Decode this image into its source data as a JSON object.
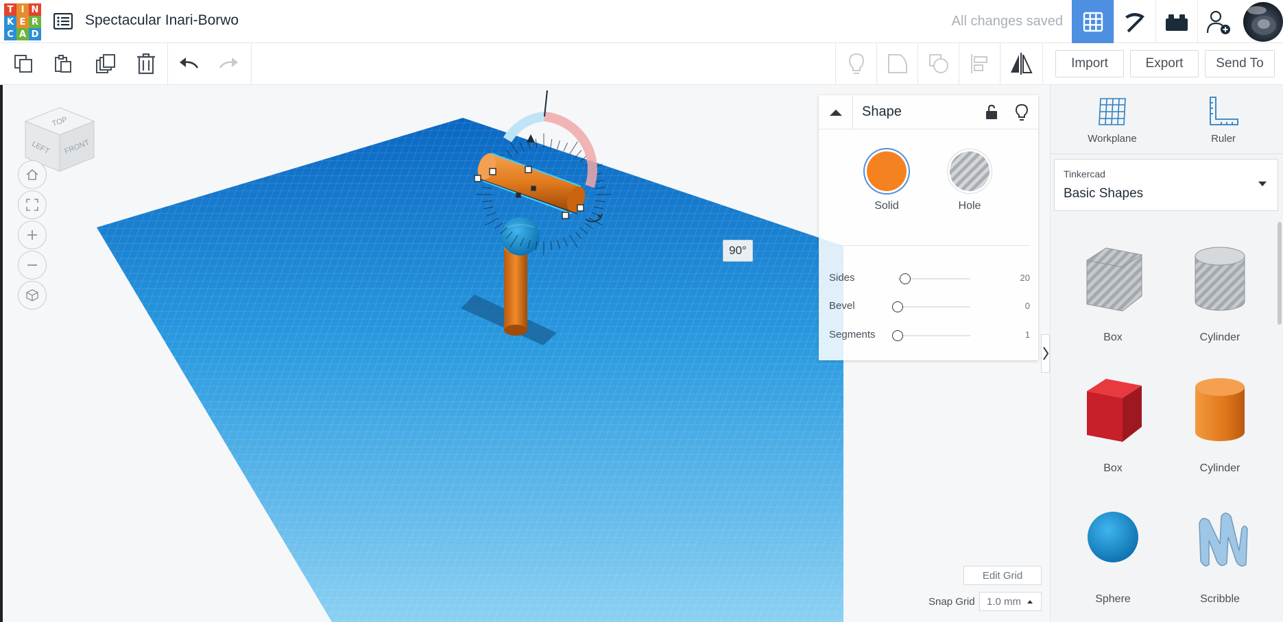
{
  "header": {
    "logo_letters": [
      "T",
      "I",
      "N",
      "K",
      "E",
      "R",
      "C",
      "A",
      "D"
    ],
    "logo_colors": [
      "#e2442c",
      "#e88b2c",
      "#e2442c",
      "#2c8fd4",
      "#e88b2c",
      "#6bb43c",
      "#2c8fd4",
      "#6bb43c",
      "#2c8fd4"
    ],
    "project_title": "Spectacular Inari-Borwo",
    "save_status": "All changes saved",
    "views": [
      "3d-design-grid-icon",
      "pickaxe-icon",
      "bricks-icon",
      "add-user-icon"
    ]
  },
  "toolbar": {
    "import_label": "Import",
    "export_label": "Export",
    "send_to_label": "Send To"
  },
  "workspace": {
    "viewcube": {
      "top": "TOP",
      "left": "LEFT",
      "front": "FRONT"
    },
    "rotation_angle": "90°",
    "edit_grid_label": "Edit Grid",
    "snap_grid_label": "Snap Grid",
    "snap_grid_value": "1.0 mm",
    "workplane_color": "#1d8fd8"
  },
  "inspector": {
    "title": "Shape",
    "solid_label": "Solid",
    "hole_label": "Hole",
    "solid_color": "#f58220",
    "properties": [
      {
        "label": "Sides",
        "value": "20",
        "level": 0.1
      },
      {
        "label": "Bevel",
        "value": "0",
        "level": 0
      },
      {
        "label": "Segments",
        "value": "1",
        "level": 0
      }
    ]
  },
  "panel": {
    "workplane_label": "Workplane",
    "ruler_label": "Ruler",
    "library_group": "Tinkercad",
    "library_name": "Basic Shapes",
    "shapes": [
      {
        "name": "Box",
        "kind": "hole-box"
      },
      {
        "name": "Cylinder",
        "kind": "hole-cylinder"
      },
      {
        "name": "Box",
        "kind": "red-box"
      },
      {
        "name": "Cylinder",
        "kind": "orange-cylinder"
      },
      {
        "name": "Sphere",
        "kind": "blue-sphere"
      },
      {
        "name": "Scribble",
        "kind": "scribble"
      }
    ]
  }
}
